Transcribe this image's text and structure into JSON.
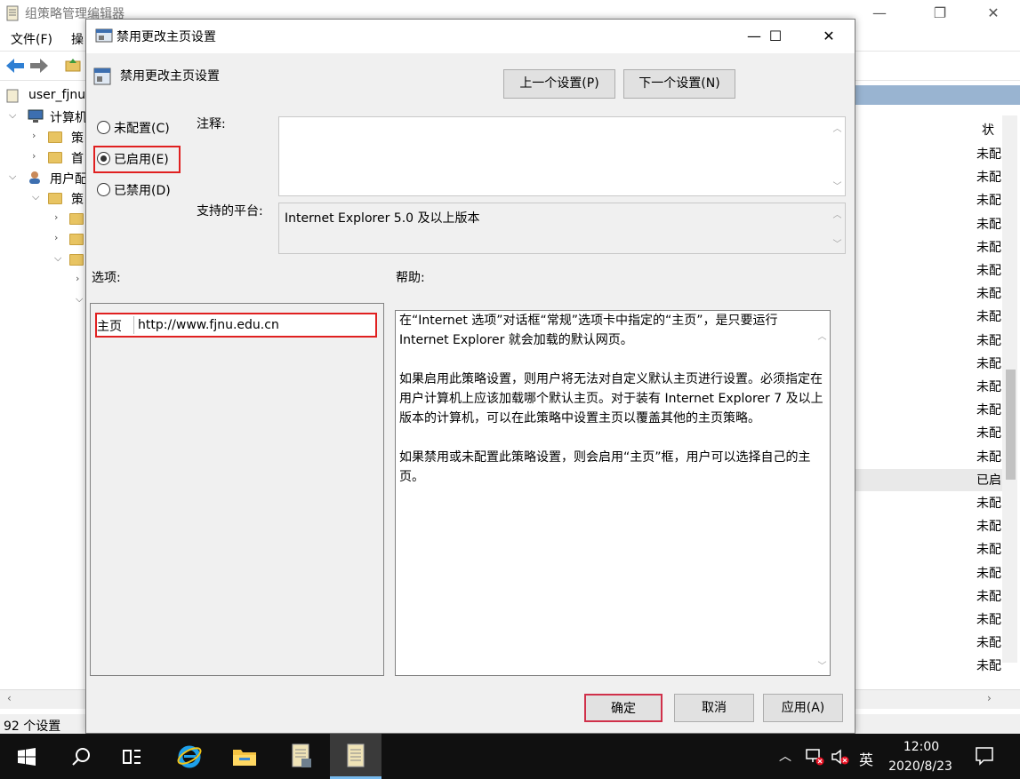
{
  "background_window": {
    "title": "组策略管理编辑器",
    "menu": [
      "文件(F)",
      "操"
    ],
    "tree": {
      "root": "user_fjnu",
      "computer": "计算机",
      "computer_children": [
        "策",
        "首"
      ],
      "user": "用户配",
      "user_children": [
        "策"
      ]
    },
    "column_header": "状",
    "status_rows": [
      "未配",
      "未配",
      "未配",
      "未配",
      "未配",
      "未配",
      "未配",
      "未配",
      "未配",
      "未配",
      "未配",
      "未配",
      "未配",
      "未配",
      "已启",
      "未配",
      "未配",
      "未配",
      "未配",
      "未配",
      "未配",
      "未配",
      "未配"
    ],
    "status_bar": "92 个设置"
  },
  "dialog": {
    "title": "禁用更改主页设置",
    "header_title": "禁用更改主页设置",
    "prev_button": "上一个设置(P)",
    "next_button": "下一个设置(N)",
    "radios": {
      "not_configured": "未配置(C)",
      "enabled": "已启用(E)",
      "disabled": "已禁用(D)",
      "selected": "enabled"
    },
    "comment_label": "注释:",
    "comment_value": "",
    "platform_label": "支持的平台:",
    "platform_value": "Internet Explorer 5.0 及以上版本",
    "options_label": "选项:",
    "help_label": "帮助:",
    "homepage": {
      "label": "主页",
      "value": "http://www.fjnu.edu.cn"
    },
    "help_paragraphs": [
      "在“Internet 选项”对话框“常规”选项卡中指定的“主页”，是只要运行 Internet Explorer 就会加载的默认网页。",
      "如果启用此策略设置，则用户将无法对自定义默认主页进行设置。必须指定在用户计算机上应该加载哪个默认主页。对于装有 Internet Explorer 7 及以上版本的计算机，可以在此策略中设置主页以覆盖其他的主页策略。",
      "如果禁用或未配置此策略设置，则会启用“主页”框，用户可以选择自己的主页。"
    ],
    "ok_button": "确定",
    "cancel_button": "取消",
    "apply_button": "应用(A)"
  },
  "taskbar": {
    "ime": "英",
    "time": "12:00",
    "date": "2020/8/23"
  },
  "colors": {
    "highlight_red": "#e02020",
    "taskbar": "#101010",
    "list_header": "#99b4d1"
  }
}
